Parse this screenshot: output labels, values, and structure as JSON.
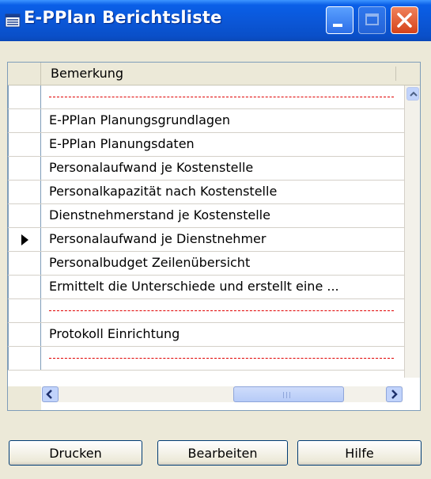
{
  "window": {
    "title": "E-PPlan Berichtsliste"
  },
  "grid": {
    "column_header": "Bemerkung",
    "rows": [
      {
        "text": "",
        "separator": true,
        "current": false
      },
      {
        "text": "E-PPlan Planungsgrundlagen",
        "separator": false,
        "current": false
      },
      {
        "text": "E-PPlan Planungsdaten",
        "separator": false,
        "current": false
      },
      {
        "text": "Personalaufwand je Kostenstelle",
        "separator": false,
        "current": false
      },
      {
        "text": "Personalkapazität nach Kostenstelle",
        "separator": false,
        "current": false
      },
      {
        "text": "Dienstnehmerstand je Kostenstelle",
        "separator": false,
        "current": false
      },
      {
        "text": "Personalaufwand je Dienstnehmer",
        "separator": false,
        "current": true
      },
      {
        "text": "Personalbudget Zeilenübersicht",
        "separator": false,
        "current": false
      },
      {
        "text": "Ermittelt die Unterschiede und erstellt eine ...",
        "separator": false,
        "current": false
      },
      {
        "text": "",
        "separator": true,
        "current": false
      },
      {
        "text": "Protokoll Einrichtung",
        "separator": false,
        "current": false
      },
      {
        "text": "",
        "separator": true,
        "current": false
      }
    ]
  },
  "buttons": {
    "print_label": "Drucken",
    "edit_label": "Bearbeiten",
    "help_label": "Hilfe"
  },
  "colors": {
    "titlebar": "#0a5fe8",
    "separator": "#e00000",
    "close": "#d5421a"
  },
  "icons": {
    "title": "list-window-icon",
    "minimize": "minimize-icon",
    "maximize": "maximize-icon",
    "close": "close-icon",
    "current_row": "current-record-arrow-icon"
  }
}
